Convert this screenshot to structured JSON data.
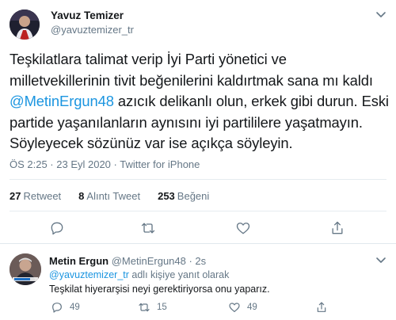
{
  "main_tweet": {
    "author_name": "Yavuz Temizer",
    "author_handle": "@yavuztemizer_tr",
    "text_part1": "Teşkilatlara talimat verip İyi Parti yönetici ve milletvekillerinin tivit beğenilerini kaldırtmak sana mı kaldı ",
    "mention": "@MetinErgun48",
    "text_part2": " azıcık delikanlı olun, erkek gibi durun. Eski partide yaşanılanların aynısını iyi partililere yaşatmayın. Söyleyecek sözünüz var ise açıkça söyleyin.",
    "meta": "ÖS 2:25 · 23 Eyl 2020 · Twitter for iPhone",
    "stats": {
      "retweets_count": "27",
      "retweets_label": "Retweet",
      "quotes_count": "8",
      "quotes_label": "Alıntı Tweet",
      "likes_count": "253",
      "likes_label": "Beğeni"
    }
  },
  "reply_tweet": {
    "author_name": "Metin Ergun",
    "author_handle": "@MetinErgun48 · 2s",
    "reply_to_handle": "@yavuztemizer_tr",
    "reply_to_suffix": " adlı kişiye yanıt olarak",
    "text": "Teşkilat hiyerarşisi neyi gerektiriyorsa onu yaparız.",
    "replies": "49",
    "retweets": "15",
    "likes": "49"
  },
  "colors": {
    "link": "#1b95e0",
    "secondary_text": "#657786",
    "icon": "#657786"
  },
  "icons": [
    "caret-down-icon",
    "reply-icon",
    "retweet-icon",
    "like-icon",
    "share-icon"
  ]
}
